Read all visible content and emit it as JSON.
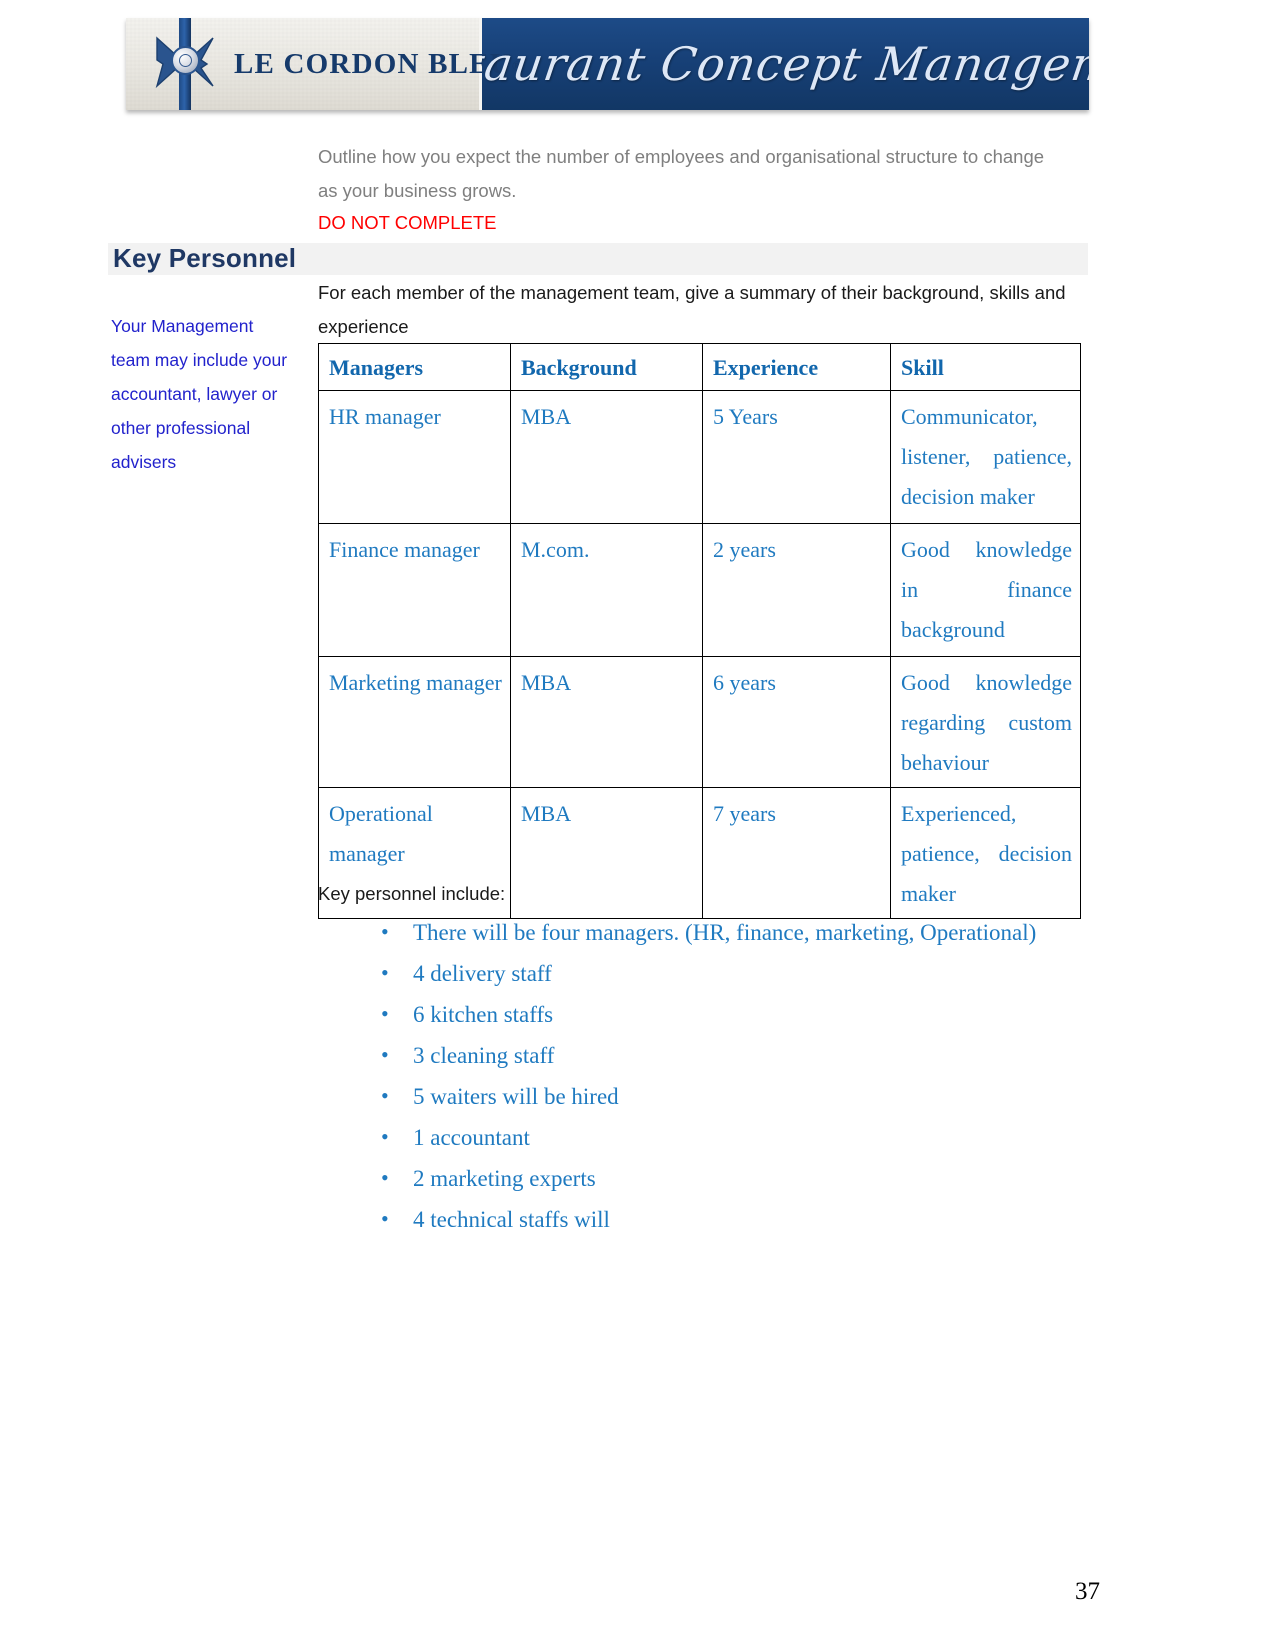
{
  "header": {
    "brand_name": "LE CORDON BLEU",
    "brand_reg": "®",
    "title_script": "Restaurant Concept Management",
    "left_bg": "#ece9e3",
    "right_bg": "#174077"
  },
  "intro": {
    "paragraph": "Outline how you expect the number of employees and organisational structure to change as your business grows.",
    "warning": "DO NOT COMPLETE",
    "warning_color": "#ff0000"
  },
  "section": {
    "title": "Key Personnel",
    "title_color": "#1f3864",
    "band_color": "#f2f2f2"
  },
  "lead": {
    "paragraph": "For each member of the management team, give a summary of their background, skills and experience"
  },
  "sidenote": {
    "text": "Your Management team may include your accountant, lawyer or other professional advisers",
    "color": "#2222cc"
  },
  "table": {
    "accent_color": "#1f7ac0",
    "headers": [
      "Managers",
      "Background",
      "Experience",
      "Skill"
    ],
    "rows": [
      {
        "manager": "HR manager",
        "background": "MBA",
        "experience": "5 Years",
        "skill": "Communicator, listener, patience, decision maker"
      },
      {
        "manager": "Finance manager",
        "background": "M.com.",
        "experience": "2 years",
        "skill": "Good knowledge in finance background"
      },
      {
        "manager": "Marketing manager",
        "background": "MBA",
        "experience": "6 years",
        "skill": "Good knowledge regarding custom behaviour"
      },
      {
        "manager": "Operational manager",
        "background": "MBA",
        "experience": "7 years",
        "skill": "Experienced, patience, decision maker"
      }
    ]
  },
  "key_personnel": {
    "intro": "Key personnel include:",
    "items": [
      "There will be four managers. (HR, finance, marketing, Operational)",
      "4 delivery staff",
      "6 kitchen staffs",
      "3 cleaning staff",
      "5 waiters will be hired",
      "1 accountant",
      "2 marketing experts",
      "4 technical staffs will"
    ]
  },
  "footer": {
    "page_number": "37"
  }
}
